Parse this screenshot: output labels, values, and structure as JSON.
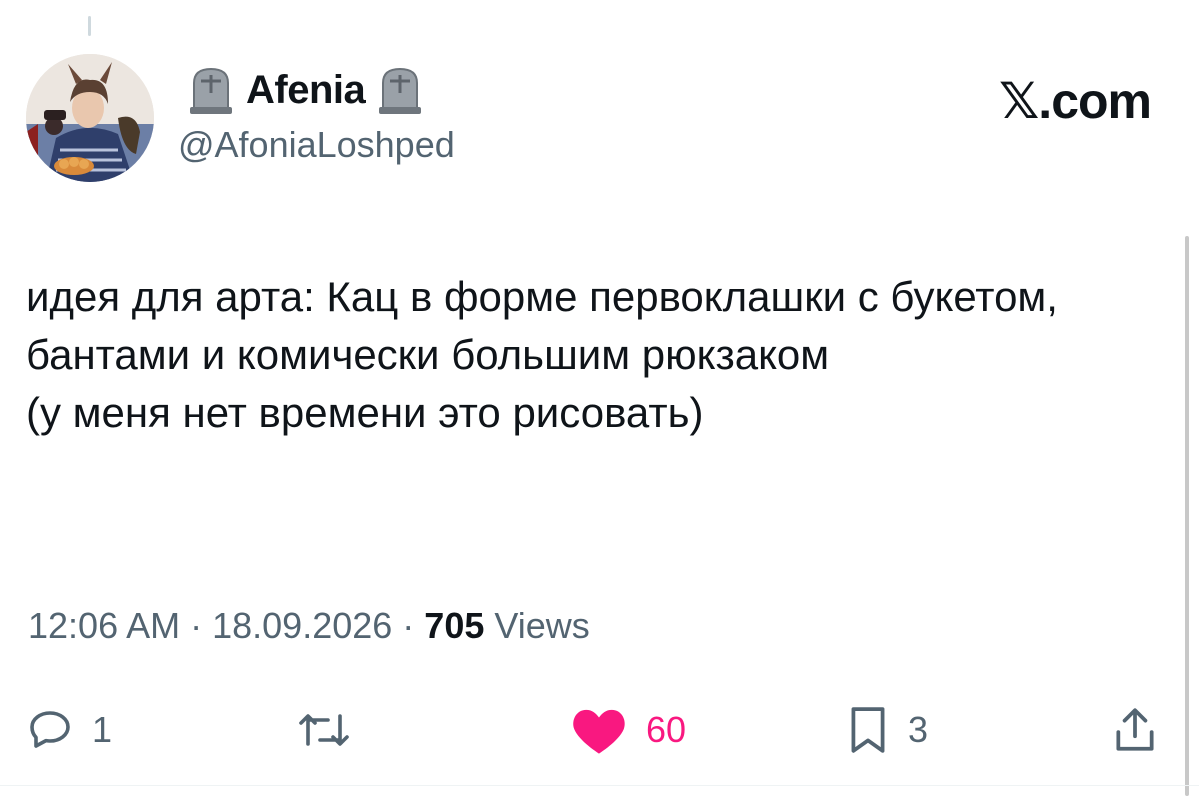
{
  "author": {
    "display_name": "Afenia",
    "handle": "@AfoniaLoshped",
    "decoration_icon": "headstone-icon"
  },
  "brand": {
    "label": "𝕏.com"
  },
  "tweet": {
    "text": "идея для арта: Кац в форме первоклашки с букетом, бантами и комически большим рюкзаком\n(у меня нет времени это рисовать)"
  },
  "meta": {
    "time": "12:06 AM",
    "separator": "·",
    "date": "18.09.2026",
    "views_count": "705",
    "views_label": "Views"
  },
  "actions": {
    "reply": {
      "icon": "reply-icon",
      "count": "1"
    },
    "retweet": {
      "icon": "retweet-icon",
      "count": ""
    },
    "like": {
      "icon": "heart-icon",
      "count": "60",
      "color": "#f91880"
    },
    "bookmark": {
      "icon": "bookmark-icon",
      "count": "3"
    },
    "share": {
      "icon": "share-icon"
    }
  },
  "colors": {
    "text": "#0f1419",
    "secondary": "#536471",
    "like": "#f91880"
  }
}
